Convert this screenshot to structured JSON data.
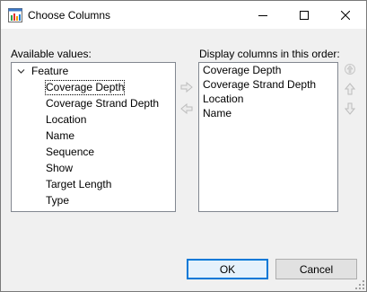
{
  "window": {
    "title": "Choose Columns",
    "minimize_icon": "minimize-icon",
    "maximize_icon": "maximize-icon",
    "close_icon": "close-icon"
  },
  "available": {
    "label": "Available values:",
    "parent": "Feature",
    "items": [
      "Coverage Depth",
      "Coverage Strand Depth",
      "Location",
      "Name",
      "Sequence",
      "Show",
      "Target Length",
      "Type"
    ]
  },
  "display": {
    "label": "Display columns in this order:",
    "items": [
      "Coverage Depth",
      "Coverage Strand Depth",
      "Location",
      "Name"
    ]
  },
  "buttons": {
    "ok": "OK",
    "cancel": "Cancel"
  },
  "icons": {
    "add": "arrow-right-icon",
    "remove": "arrow-left-icon",
    "move_top": "move-to-top-icon",
    "move_up": "move-up-icon",
    "move_down": "move-down-icon"
  },
  "colors": {
    "focus_border": "#0078d7",
    "disabled_arrow": "#c8c8c8"
  }
}
